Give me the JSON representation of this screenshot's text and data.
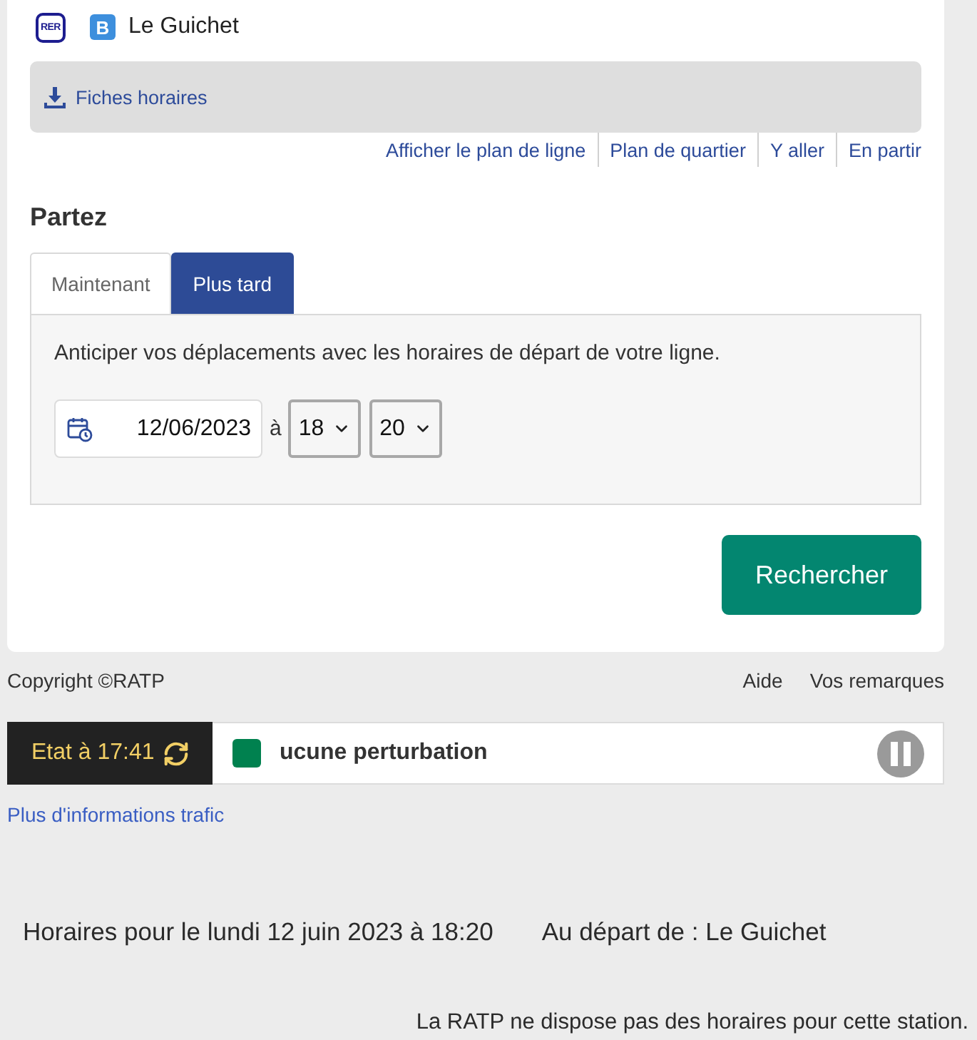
{
  "header": {
    "network_logo": "RER",
    "line_badge": "B",
    "station": "Le Guichet"
  },
  "downloads": {
    "label": "Fiches horaires"
  },
  "links": [
    "Afficher le plan de ligne",
    "Plan de quartier",
    "Y aller",
    "En partir"
  ],
  "departure": {
    "title": "Partez",
    "tabs": [
      {
        "label": "Maintenant",
        "selected": false
      },
      {
        "label": "Plus tard",
        "selected": true
      }
    ],
    "description": "Anticiper vos déplacements avec les horaires de départ de votre ligne.",
    "date": "12/06/2023",
    "separator": "à",
    "hour": "18",
    "minute": "20",
    "search_button": "Rechercher"
  },
  "footer": {
    "copyright": "Copyright ©RATP",
    "links": [
      "Aide",
      "Vos remarques"
    ]
  },
  "traffic": {
    "status": "Etat à 17:41",
    "message": "ucune perturbation",
    "color": "#00814f",
    "more_link": "Plus d'informations trafic"
  },
  "schedule": {
    "heading": "Horaires pour le lundi 12 juin 2023 à 18:20",
    "station": "Au départ de : Le Guichet",
    "notice": "La RATP ne dispose pas des horaires pour cette station."
  }
}
